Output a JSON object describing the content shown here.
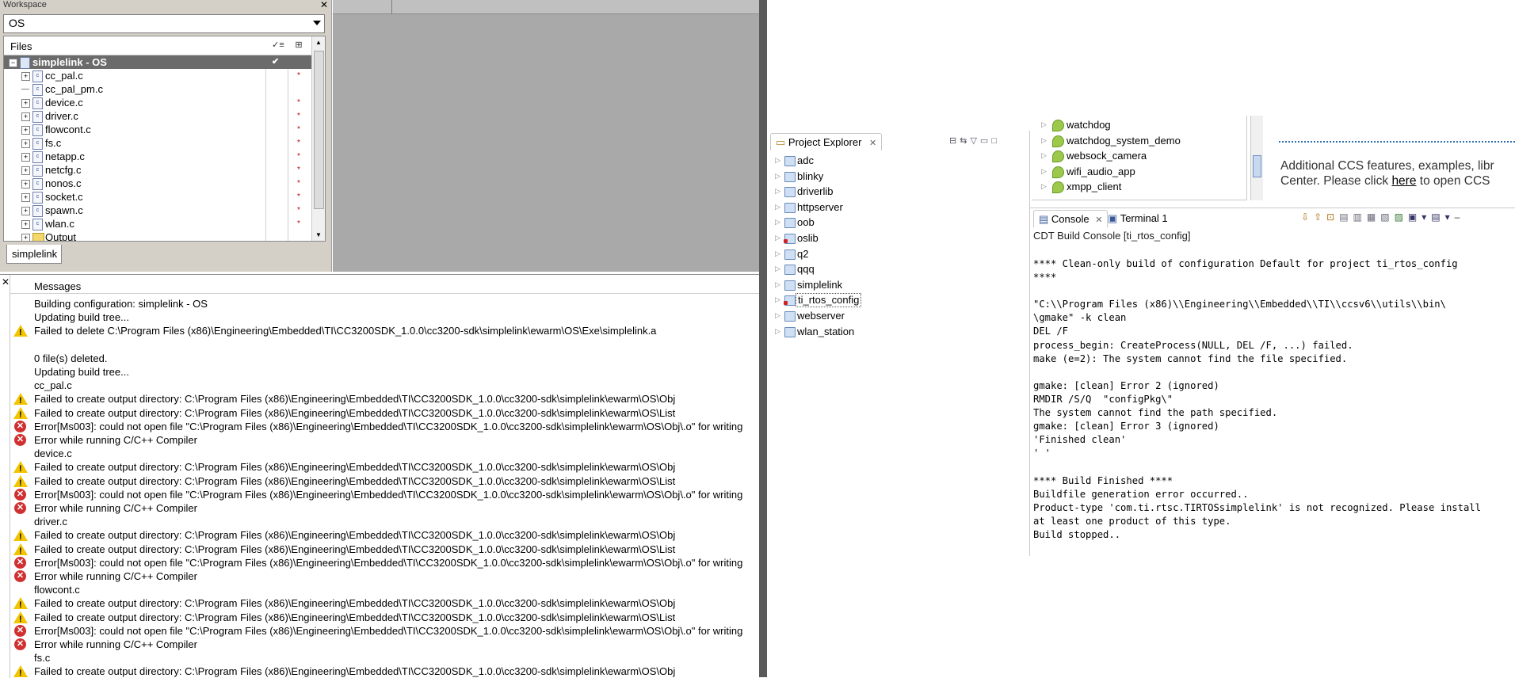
{
  "workspace": {
    "title": "Workspace",
    "configuration": "OS",
    "files_header": "Files",
    "project": "simplelink - OS",
    "files": [
      {
        "name": "cc_pal.c",
        "mark": "*"
      },
      {
        "name": "cc_pal_pm.c",
        "mark": ""
      },
      {
        "name": "device.c",
        "mark": "*"
      },
      {
        "name": "driver.c",
        "mark": "*"
      },
      {
        "name": "flowcont.c",
        "mark": "*"
      },
      {
        "name": "fs.c",
        "mark": "*"
      },
      {
        "name": "netapp.c",
        "mark": "*"
      },
      {
        "name": "netcfg.c",
        "mark": "*"
      },
      {
        "name": "nonos.c",
        "mark": "*"
      },
      {
        "name": "socket.c",
        "mark": "*"
      },
      {
        "name": "spawn.c",
        "mark": "*"
      },
      {
        "name": "wlan.c",
        "mark": "*"
      },
      {
        "name": "Output",
        "mark": ""
      }
    ],
    "tab": "simplelink"
  },
  "messages": {
    "header": "Messages",
    "rows": [
      {
        "icon": "",
        "text": "Building configuration: simplelink - OS"
      },
      {
        "icon": "",
        "text": "Updating build tree..."
      },
      {
        "icon": "warn",
        "text": "Failed to delete C:\\Program Files (x86)\\Engineering\\Embedded\\TI\\CC3200SDK_1.0.0\\cc3200-sdk\\simplelink\\ewarm\\OS\\Exe\\simplelink.a"
      },
      {
        "icon": "",
        "text": ""
      },
      {
        "icon": "",
        "text": "0  file(s) deleted."
      },
      {
        "icon": "",
        "text": "Updating build tree..."
      },
      {
        "icon": "",
        "text": "cc_pal.c"
      },
      {
        "icon": "warn",
        "text": "Failed to create output directory: C:\\Program Files (x86)\\Engineering\\Embedded\\TI\\CC3200SDK_1.0.0\\cc3200-sdk\\simplelink\\ewarm\\OS\\Obj"
      },
      {
        "icon": "warn",
        "text": "Failed to create output directory: C:\\Program Files (x86)\\Engineering\\Embedded\\TI\\CC3200SDK_1.0.0\\cc3200-sdk\\simplelink\\ewarm\\OS\\List"
      },
      {
        "icon": "err",
        "text": "Error[Ms003]: could not open file \"C:\\Program Files (x86)\\Engineering\\Embedded\\TI\\CC3200SDK_1.0.0\\cc3200-sdk\\simplelink\\ewarm\\OS\\Obj\\.o\" for writing"
      },
      {
        "icon": "err",
        "text": "Error while running C/C++ Compiler"
      },
      {
        "icon": "",
        "text": "device.c"
      },
      {
        "icon": "warn",
        "text": "Failed to create output directory: C:\\Program Files (x86)\\Engineering\\Embedded\\TI\\CC3200SDK_1.0.0\\cc3200-sdk\\simplelink\\ewarm\\OS\\Obj"
      },
      {
        "icon": "warn",
        "text": "Failed to create output directory: C:\\Program Files (x86)\\Engineering\\Embedded\\TI\\CC3200SDK_1.0.0\\cc3200-sdk\\simplelink\\ewarm\\OS\\List"
      },
      {
        "icon": "err",
        "text": "Error[Ms003]: could not open file \"C:\\Program Files (x86)\\Engineering\\Embedded\\TI\\CC3200SDK_1.0.0\\cc3200-sdk\\simplelink\\ewarm\\OS\\Obj\\.o\" for writing"
      },
      {
        "icon": "err",
        "text": "Error while running C/C++ Compiler"
      },
      {
        "icon": "",
        "text": "driver.c"
      },
      {
        "icon": "warn",
        "text": "Failed to create output directory: C:\\Program Files (x86)\\Engineering\\Embedded\\TI\\CC3200SDK_1.0.0\\cc3200-sdk\\simplelink\\ewarm\\OS\\Obj"
      },
      {
        "icon": "warn",
        "text": "Failed to create output directory: C:\\Program Files (x86)\\Engineering\\Embedded\\TI\\CC3200SDK_1.0.0\\cc3200-sdk\\simplelink\\ewarm\\OS\\List"
      },
      {
        "icon": "err",
        "text": "Error[Ms003]: could not open file \"C:\\Program Files (x86)\\Engineering\\Embedded\\TI\\CC3200SDK_1.0.0\\cc3200-sdk\\simplelink\\ewarm\\OS\\Obj\\.o\" for writing"
      },
      {
        "icon": "err",
        "text": "Error while running C/C++ Compiler"
      },
      {
        "icon": "",
        "text": "flowcont.c"
      },
      {
        "icon": "warn",
        "text": "Failed to create output directory: C:\\Program Files (x86)\\Engineering\\Embedded\\TI\\CC3200SDK_1.0.0\\cc3200-sdk\\simplelink\\ewarm\\OS\\Obj"
      },
      {
        "icon": "warn",
        "text": "Failed to create output directory: C:\\Program Files (x86)\\Engineering\\Embedded\\TI\\CC3200SDK_1.0.0\\cc3200-sdk\\simplelink\\ewarm\\OS\\List"
      },
      {
        "icon": "err",
        "text": "Error[Ms003]: could not open file \"C:\\Program Files (x86)\\Engineering\\Embedded\\TI\\CC3200SDK_1.0.0\\cc3200-sdk\\simplelink\\ewarm\\OS\\Obj\\.o\" for writing"
      },
      {
        "icon": "err",
        "text": "Error while running C/C++ Compiler"
      },
      {
        "icon": "",
        "text": "fs.c"
      },
      {
        "icon": "warn",
        "text": "Failed to create output directory: C:\\Program Files (x86)\\Engineering\\Embedded\\TI\\CC3200SDK_1.0.0\\cc3200-sdk\\simplelink\\ewarm\\OS\\Obj"
      }
    ]
  },
  "project_explorer": {
    "title": "Project Explorer",
    "projects": [
      {
        "name": "adc",
        "error": false
      },
      {
        "name": "blinky",
        "error": false
      },
      {
        "name": "driverlib",
        "error": false
      },
      {
        "name": "httpserver",
        "error": false
      },
      {
        "name": "oob",
        "error": false
      },
      {
        "name": "oslib",
        "error": true
      },
      {
        "name": "q2",
        "error": false
      },
      {
        "name": "qqq",
        "error": false
      },
      {
        "name": "simplelink",
        "error": false
      },
      {
        "name": "ti_rtos_config",
        "error": true
      },
      {
        "name": "webserver",
        "error": false
      },
      {
        "name": "wlan_station",
        "error": false
      }
    ],
    "selected": "ti_rtos_config"
  },
  "examples": [
    "watchdog",
    "watchdog_system_demo",
    "websock_camera",
    "wifi_audio_app",
    "xmpp_client"
  ],
  "welcome": {
    "line1": "Additional CCS features, examples, libr",
    "line2_before": "Center. Please click ",
    "link": "here",
    "line2_after": " to open CCS"
  },
  "console": {
    "tab": "Console",
    "tab2": "Terminal 1",
    "label": "CDT Build Console [ti_rtos_config]",
    "lines": [
      "**** Clean-only build of configuration Default for project ti_rtos_config",
      "****",
      "",
      "\"C:\\\\Program Files (x86)\\\\Engineering\\\\Embedded\\\\TI\\\\ccsv6\\\\utils\\\\bin\\",
      "\\gmake\" -k clean",
      "DEL /F",
      "process_begin: CreateProcess(NULL, DEL /F, ...) failed.",
      "make (e=2): The system cannot find the file specified.",
      "",
      "gmake: [clean] Error 2 (ignored)",
      "RMDIR /S/Q  \"configPkg\\\"",
      "The system cannot find the path specified.",
      "gmake: [clean] Error 3 (ignored)",
      "'Finished clean'",
      "' '",
      "",
      "**** Build Finished ****",
      "Buildfile generation error occurred..",
      "Product-type 'com.ti.rtsc.TIRTOSsimplelink' is not recognized. Please install",
      "at least one product of this type.",
      "Build stopped.."
    ]
  }
}
